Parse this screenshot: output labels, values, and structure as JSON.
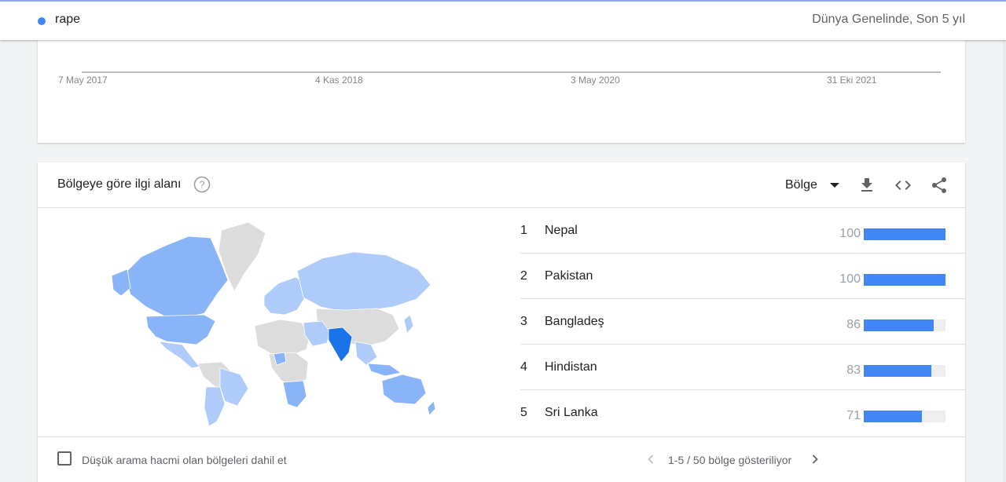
{
  "header": {
    "term": "rape",
    "scope": "Dünya Genelinde, Son 5 yıl",
    "term_color": "#4285f4"
  },
  "timeline": {
    "axis_labels": [
      "7 May 2017",
      "4 Kas 2018",
      "3 May 2020",
      "31 Eki 2021"
    ]
  },
  "region_card": {
    "title": "Bölgeye göre ilgi alanı",
    "help_icon": "help-circle-icon",
    "dropdown_value": "Bölge",
    "tools": [
      "download-icon",
      "embed-code-icon",
      "share-icon"
    ],
    "rankings": [
      {
        "rank": "1",
        "name": "Nepal",
        "value": "100",
        "fraction": 1.0
      },
      {
        "rank": "2",
        "name": "Pakistan",
        "value": "100",
        "fraction": 1.0
      },
      {
        "rank": "3",
        "name": "Bangladeş",
        "value": "86",
        "fraction": 0.86
      },
      {
        "rank": "4",
        "name": "Hindistan",
        "value": "83",
        "fraction": 0.83
      },
      {
        "rank": "5",
        "name": "Sri Lanka",
        "value": "71",
        "fraction": 0.71
      }
    ],
    "bar_color": "#4285f4",
    "map_colors": {
      "none": "#dcdcdc",
      "low": "#aecbfa",
      "mid": "#8ab4f8",
      "high": "#1a73e8"
    },
    "low_volume_checkbox": {
      "label": "Düşük arama hacmi olan bölgeleri dahil et",
      "checked": false
    },
    "pagination": "1-5 / 50 bölge gösteriliyor"
  }
}
